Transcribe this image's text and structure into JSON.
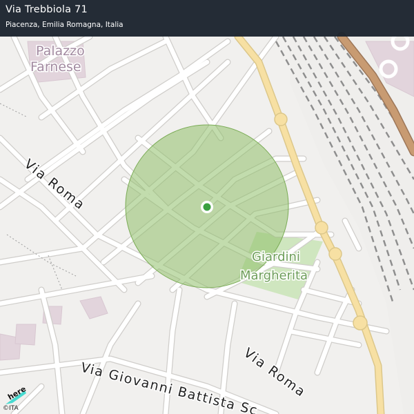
{
  "header": {
    "title": "Via Trebbiola 71",
    "subtitle": "Piacenza, Emilia Romagna, Italia"
  },
  "map": {
    "labels": {
      "poi_1_line1": "Palazzo",
      "poi_1_line2": "Farnese",
      "park_line1": "Giardini",
      "park_line2": "Margherita",
      "street_1": "Via Roma",
      "street_2": "Via Roma",
      "street_3": "Via  Giovanni  Battista  Sc"
    },
    "accuracy_circle": {
      "color": "#8fbf6a"
    },
    "location_marker": {
      "color": "#3aa040"
    }
  },
  "footer": {
    "brand": "here",
    "credit": "©ITA"
  },
  "colors": {
    "background": "#f1f0ee",
    "road": "#ffffff",
    "road_casing": "#cfcdca",
    "main_road": "#f7e0a3",
    "highway": "#c89b72",
    "park": "#cfe6bf",
    "building": "#e2d4dc",
    "railway": "#8e8e8e"
  }
}
